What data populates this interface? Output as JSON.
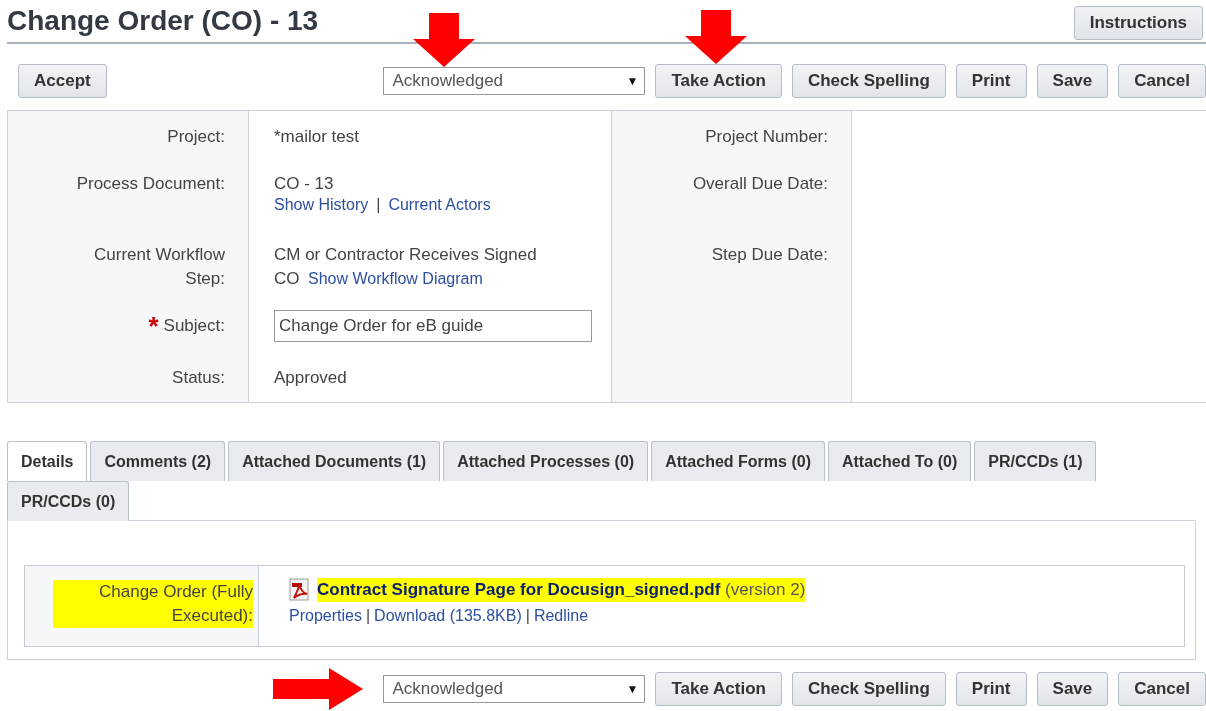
{
  "title": "Change Order (CO) - 13",
  "link_separator": "|",
  "dropdown_caret": "▼",
  "header_buttons": [
    "Instructions"
  ],
  "top_toolbar": {
    "left_buttons": [
      "Accept"
    ],
    "action_select": "Acknowledged",
    "select_marked": true,
    "buttons": [
      {
        "label": "Take Action",
        "marked": true
      },
      {
        "label": "Check Spelling",
        "marked": false
      },
      {
        "label": "Print",
        "marked": false
      },
      {
        "label": "Save",
        "marked": false
      },
      {
        "label": "Cancel",
        "marked": false
      }
    ]
  },
  "form_left": [
    {
      "kind": "text",
      "label": "Project:",
      "value": "*mailor test"
    },
    {
      "kind": "links",
      "label": "Process Document:",
      "value": "CO - 13",
      "links": [
        "Show History",
        "Current Actors"
      ]
    },
    {
      "kind": "inline_link",
      "label": "Current Workflow Step:",
      "value": "CM or Contractor Receives Signed",
      "value_end": "CO",
      "links": [
        "Show Workflow Diagram"
      ]
    },
    {
      "kind": "input",
      "label": "Subject:",
      "required": true,
      "required_mark": "*",
      "value": "Change Order for eB guide"
    },
    {
      "kind": "text",
      "label": "Status:",
      "value": "Approved"
    }
  ],
  "form_right": [
    {
      "label": "Project Number:"
    },
    {
      "label": "Overall Due Date:"
    },
    {
      "label": "Step Due Date:"
    }
  ],
  "tabs": [
    {
      "label": "Details",
      "selected": true
    },
    {
      "label": "Comments (2)",
      "selected": false
    },
    {
      "label": "Attached Documents (1)",
      "selected": false
    },
    {
      "label": "Attached Processes (0)",
      "selected": false
    },
    {
      "label": "Attached Forms (0)",
      "selected": false
    },
    {
      "label": "Attached To (0)",
      "selected": false
    },
    {
      "label": "PR/CCDs (1)",
      "selected": false
    },
    {
      "label": "PR/CCDs (0)",
      "selected": false
    }
  ],
  "attachment": {
    "label": "Change Order (Fully Executed):",
    "highlighted": true,
    "file": "Contract Signature Page for Docusign_signed.pdf",
    "version": "(version 2)",
    "links": [
      "Properties",
      "Download (135.8KB)",
      "Redline"
    ]
  },
  "bottom_toolbar": {
    "action_select": "Acknowledged",
    "select_marked": true,
    "buttons": [
      "Take Action",
      "Check Spelling",
      "Print",
      "Save",
      "Cancel"
    ]
  }
}
